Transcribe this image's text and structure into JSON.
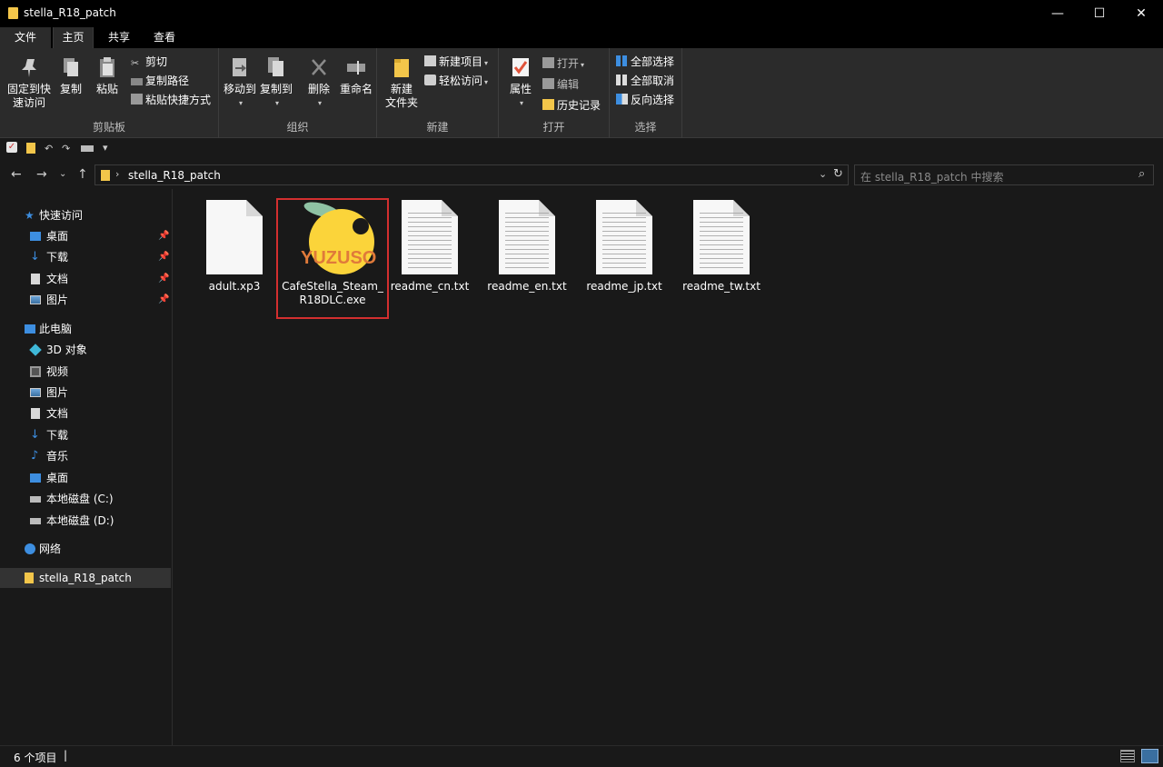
{
  "window": {
    "title": "stella_R18_patch"
  },
  "tabs": {
    "file": "文件",
    "home": "主页",
    "share": "共享",
    "view": "查看"
  },
  "ribbon": {
    "clipboard": {
      "label": "剪贴板",
      "pin": "固定到快\n速访问",
      "pin_l1": "固定到快",
      "pin_l2": "速访问",
      "copy": "复制",
      "paste": "粘贴",
      "cut": "剪切",
      "copy_path": "复制路径",
      "paste_shortcut": "粘贴快捷方式"
    },
    "organize": {
      "label": "组织",
      "move_to": "移动到",
      "copy_to": "复制到",
      "delete": "删除",
      "rename": "重命名"
    },
    "new": {
      "label": "新建",
      "new_folder_l1": "新建",
      "new_folder_l2": "文件夹",
      "new_item": "新建项目",
      "easy_access": "轻松访问"
    },
    "open": {
      "label": "打开",
      "properties": "属性",
      "open": "打开",
      "edit": "编辑",
      "history": "历史记录"
    },
    "select": {
      "label": "选择",
      "select_all": "全部选择",
      "select_none": "全部取消",
      "invert": "反向选择"
    }
  },
  "address": {
    "path": "stella_R18_patch",
    "search_placeholder": "在 stella_R18_patch 中搜索"
  },
  "nav": {
    "quick_access": "快速访问",
    "quick_items": [
      "桌面",
      "下载",
      "文档",
      "图片"
    ],
    "this_pc": "此电脑",
    "pc_items": [
      "3D 对象",
      "视频",
      "图片",
      "文档",
      "下载",
      "音乐",
      "桌面",
      "本地磁盘 (C:)",
      "本地磁盘 (D:)"
    ],
    "network": "网络",
    "current": "stella_R18_patch"
  },
  "files": [
    {
      "name": "adult.xp3",
      "icon": "blank-file-icon"
    },
    {
      "name": "CafeStella_Steam_R18DLC.exe",
      "icon": "yuzusoft-app-icon",
      "logo_text": "YUZUSOFT"
    },
    {
      "name": "readme_cn.txt",
      "icon": "text-file-icon"
    },
    {
      "name": "readme_en.txt",
      "icon": "text-file-icon"
    },
    {
      "name": "readme_jp.txt",
      "icon": "text-file-icon"
    },
    {
      "name": "readme_tw.txt",
      "icon": "text-file-icon"
    }
  ],
  "status": {
    "count": "6 个项目"
  },
  "colors": {
    "selection_border": "#d32f2f",
    "folder": "#f3c64a",
    "accent": "#1f6fd6"
  }
}
